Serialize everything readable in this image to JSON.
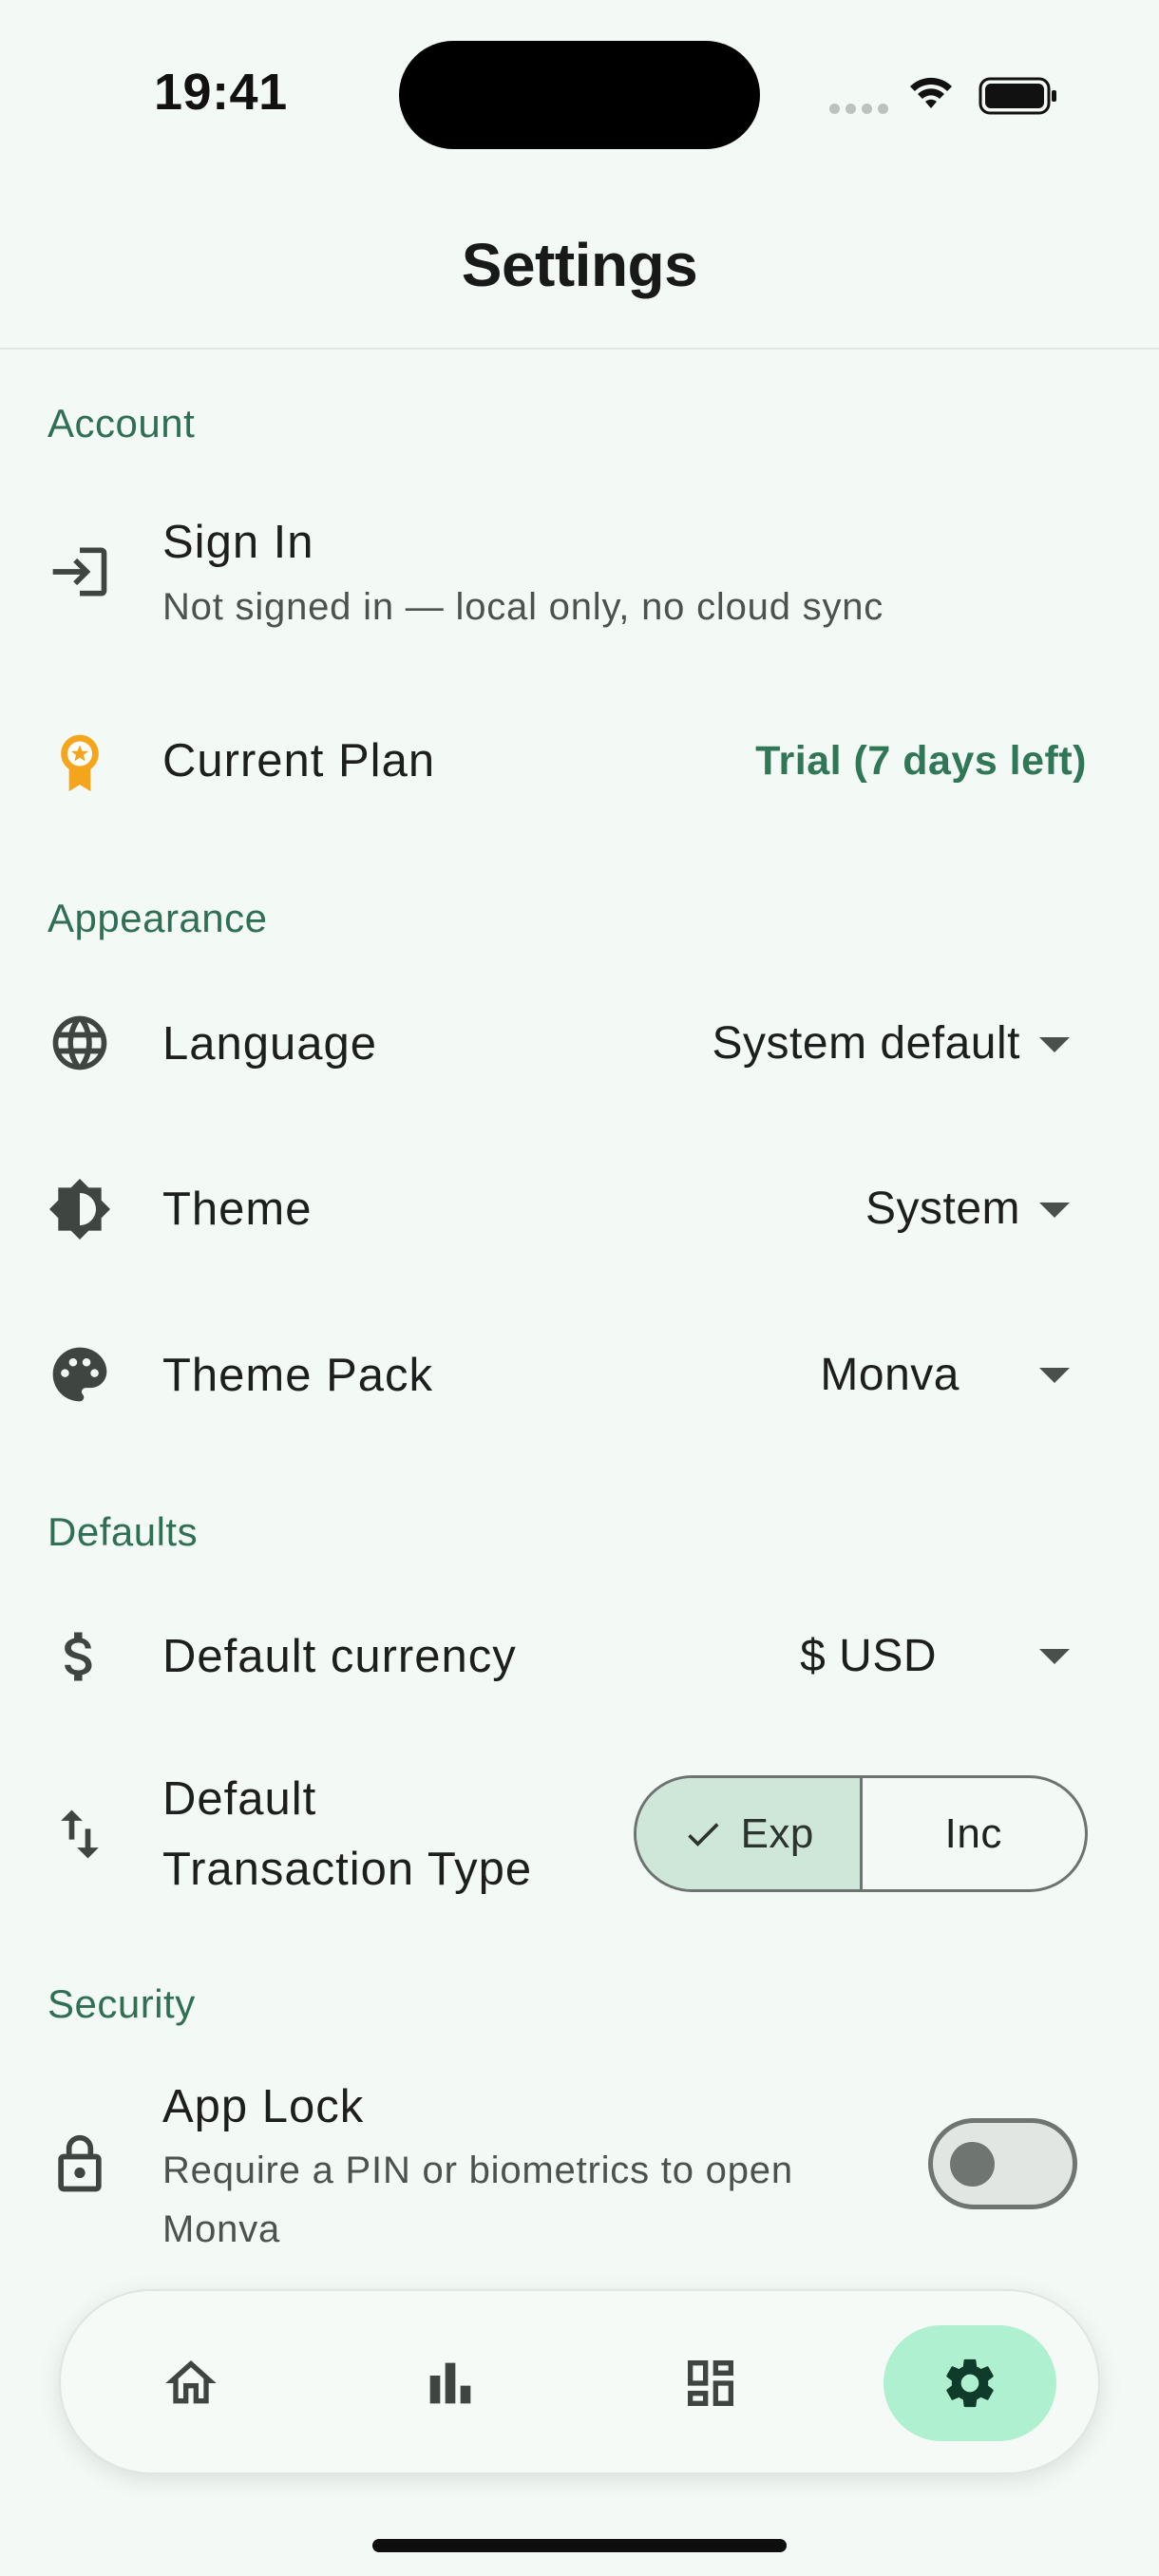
{
  "status_bar": {
    "time": "19:41"
  },
  "header": {
    "title": "Settings"
  },
  "sections": {
    "account": {
      "title": "Account",
      "sign_in": {
        "label": "Sign In",
        "subtitle": "Not signed in — local only, no cloud sync",
        "icon": "login-icon"
      },
      "current_plan": {
        "label": "Current Plan",
        "value": "Trial (7 days left)",
        "icon": "award-badge-icon"
      }
    },
    "appearance": {
      "title": "Appearance",
      "language": {
        "label": "Language",
        "value": "System default",
        "icon": "globe-icon"
      },
      "theme": {
        "label": "Theme",
        "value": "System",
        "icon": "brightness-icon"
      },
      "theme_pack": {
        "label": "Theme Pack",
        "value": "Monva",
        "icon": "palette-icon"
      }
    },
    "defaults": {
      "title": "Defaults",
      "currency": {
        "label": "Default currency",
        "value": "$ USD",
        "icon": "dollar-icon"
      },
      "transaction_type": {
        "label_line1": "Default",
        "label_line2": "Transaction Type",
        "icon": "swap-vertical-icon",
        "options": [
          "Exp",
          "Inc"
        ],
        "selected": "Exp"
      }
    },
    "security": {
      "title": "Security",
      "app_lock": {
        "label": "App Lock",
        "subtitle_line1": "Require a PIN or biometrics to open",
        "subtitle_line2": "Monva",
        "icon": "lock-icon",
        "enabled": false
      }
    }
  },
  "bottom_nav": {
    "items": [
      {
        "name": "home",
        "icon": "home-icon",
        "active": false
      },
      {
        "name": "stats",
        "icon": "bar-chart-icon",
        "active": false
      },
      {
        "name": "dashboard",
        "icon": "dashboard-icon",
        "active": false
      },
      {
        "name": "settings",
        "icon": "gear-icon",
        "active": true
      }
    ]
  },
  "colors": {
    "background": "#f3f9f4",
    "accent": "#2f6f54",
    "plan_value": "#2f7756",
    "selected_segment": "#cfe7d8",
    "nav_active": "#aef0d0",
    "plan_icon": "#f4a51c"
  }
}
